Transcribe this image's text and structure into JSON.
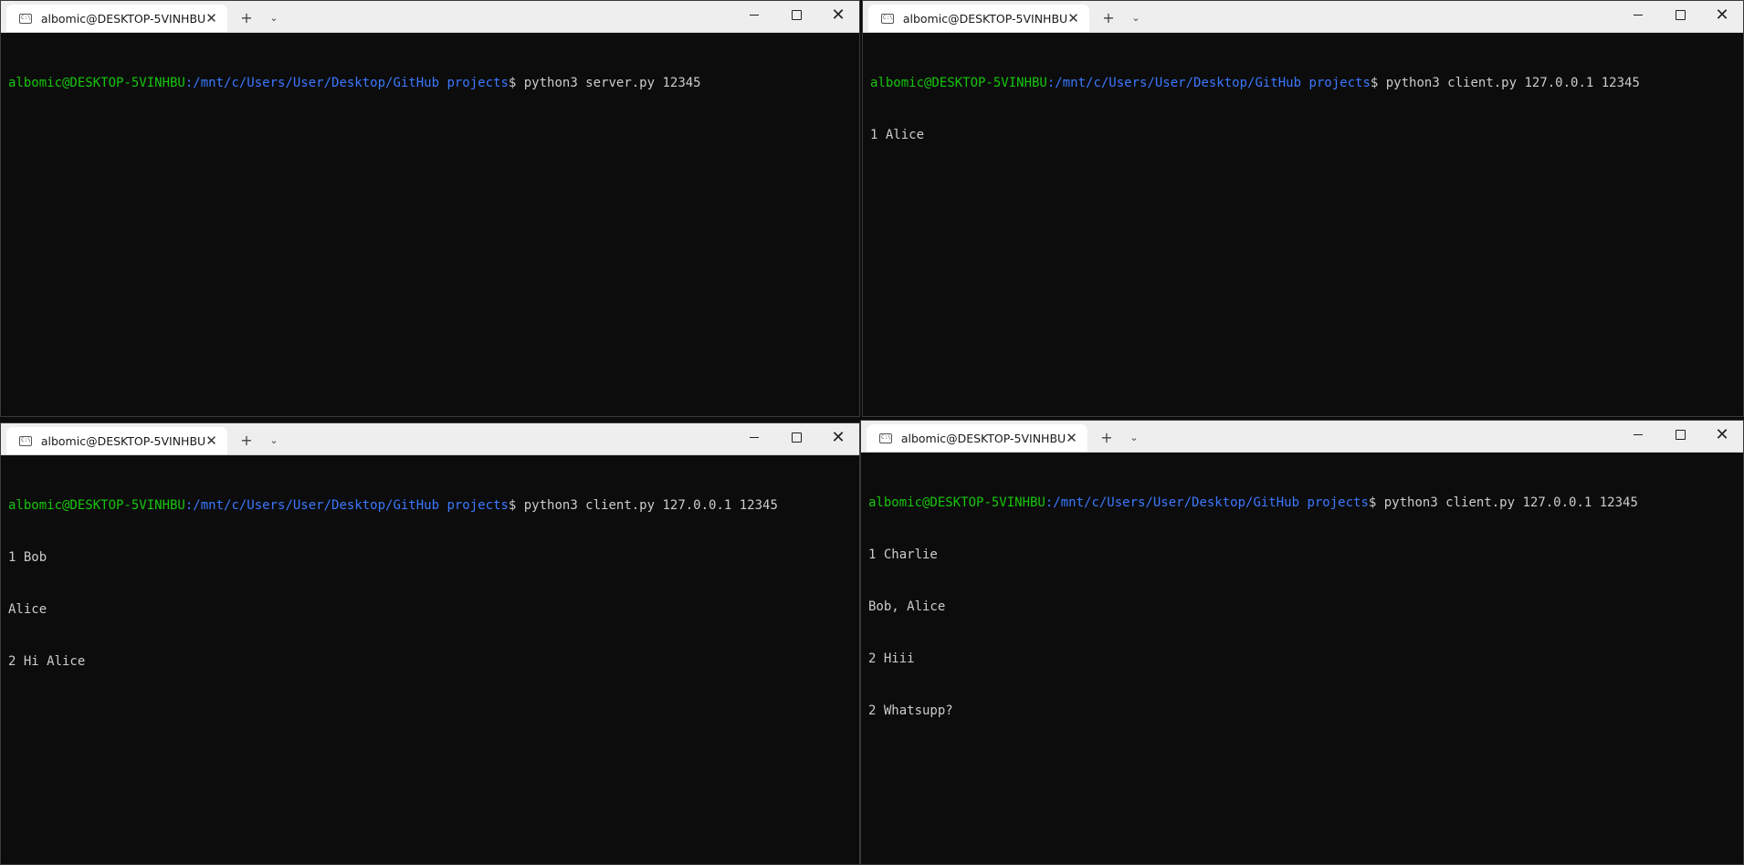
{
  "windows": [
    {
      "tab_title": "albomic@DESKTOP-5VINHBU",
      "prompt": {
        "user": "albomic@DESKTOP-5VINHBU",
        "path": ":/mnt/c/Users/User/Desktop/GitHub projects",
        "command": "$ python3 server.py 12345"
      },
      "output": []
    },
    {
      "tab_title": "albomic@DESKTOP-5VINHBU",
      "prompt": {
        "user": "albomic@DESKTOP-5VINHBU",
        "path": ":/mnt/c/Users/User/Desktop/GitHub projects",
        "command": "$ python3 client.py 127.0.0.1 12345"
      },
      "output": [
        "1 Alice"
      ]
    },
    {
      "tab_title": "albomic@DESKTOP-5VINHBU",
      "prompt": {
        "user": "albomic@DESKTOP-5VINHBU",
        "path": ":/mnt/c/Users/User/Desktop/GitHub projects",
        "command": "$ python3 client.py 127.0.0.1 12345"
      },
      "output": [
        "1 Bob",
        "Alice",
        "2 Hi Alice"
      ]
    },
    {
      "tab_title": "albomic@DESKTOP-5VINHBU",
      "prompt": {
        "user": "albomic@DESKTOP-5VINHBU",
        "path": ":/mnt/c/Users/User/Desktop/GitHub projects",
        "command": "$ python3 client.py 127.0.0.1 12345"
      },
      "output": [
        "1 Charlie",
        "Bob, Alice",
        "2 Hiii",
        "2 Whatsupp?"
      ]
    }
  ],
  "icons": {
    "tab": "terminal-icon",
    "close": "close-icon",
    "new_tab": "plus-icon",
    "dropdown": "chevron-down-icon",
    "minimize": "minimize-icon",
    "maximize": "maximize-icon"
  },
  "glyphs": {
    "close": "✕",
    "plus": "+",
    "chevron": "⌄",
    "terminal": "C:\\"
  },
  "colors": {
    "user": "#16c60c",
    "path": "#3b78ff",
    "text": "#cccccc",
    "background": "#0c0c0c"
  }
}
